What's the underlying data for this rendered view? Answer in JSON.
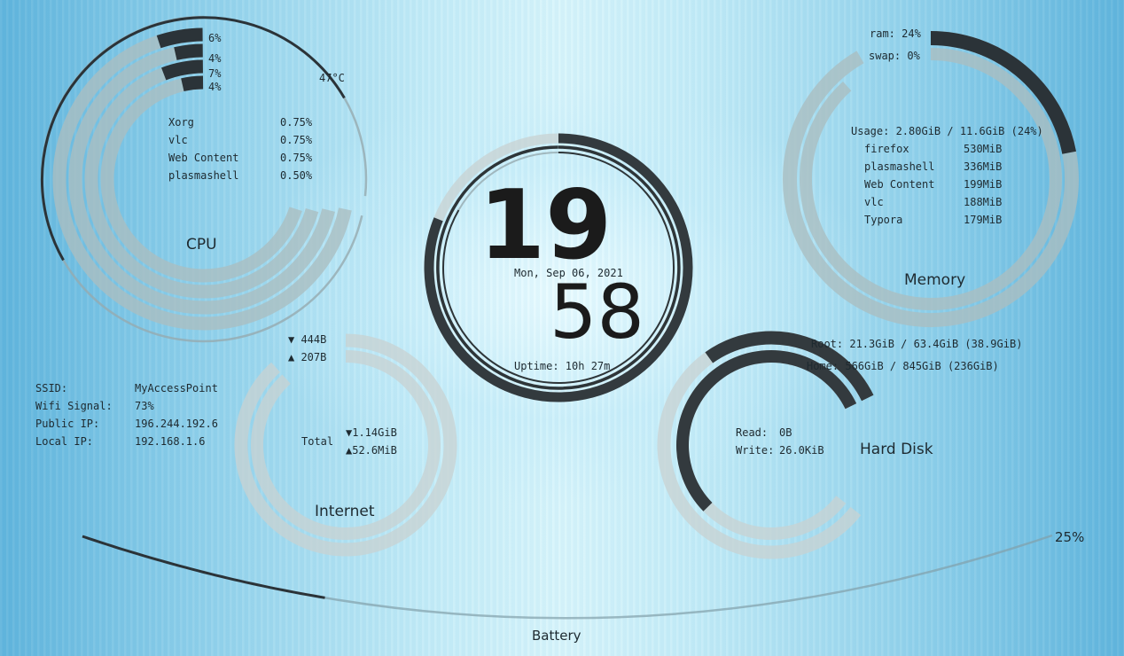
{
  "colors": {
    "dark": "#2b3338",
    "track": "rgba(170,190,192,0.78)",
    "track_light": "rgba(200,210,210,0.75)",
    "thin_light": "rgba(150,170,175,0.8)"
  },
  "cpu": {
    "title": "CPU",
    "temp": "47°C",
    "cores": [
      "6%",
      "4%",
      "7%",
      "4%"
    ],
    "core_values": [
      6,
      4,
      7,
      4
    ],
    "temp_value": 47,
    "top": [
      {
        "name": "Xorg",
        "value": "0.75%"
      },
      {
        "name": "vlc",
        "value": "0.75%"
      },
      {
        "name": "Web Content",
        "value": "0.75%"
      },
      {
        "name": "plasmashell",
        "value": "0.50%"
      }
    ]
  },
  "clock": {
    "hour": "19",
    "minute": "58",
    "date": "Mon, Sep 06, 2021",
    "uptime": "Uptime: 10h 27m"
  },
  "memory": {
    "title": "Memory",
    "ram": "ram: 24%",
    "swap": "swap: 0%",
    "ram_value": 24,
    "swap_value": 0,
    "usage": "Usage: 2.80GiB / 11.6GiB (24%)",
    "top": [
      {
        "name": "firefox",
        "value": "530MiB"
      },
      {
        "name": "plasmashell",
        "value": "336MiB"
      },
      {
        "name": "Web Content",
        "value": "199MiB"
      },
      {
        "name": "vlc",
        "value": "188MiB"
      },
      {
        "name": "Typora",
        "value": "179MiB"
      }
    ]
  },
  "network": {
    "title": "Internet",
    "down_rate": "▼ 444B",
    "up_rate": "▲ 207B",
    "total_label": "Total",
    "total_down": "▼1.14GiB",
    "total_up": "▲52.6MiB",
    "info": [
      {
        "label": "SSID:",
        "value": "MyAccessPoint"
      },
      {
        "label": "Wifi Signal:",
        "value": "73%"
      },
      {
        "label": "Public IP:",
        "value": "196.244.192.6"
      },
      {
        "label": "Local IP:",
        "value": "192.168.1.6"
      }
    ]
  },
  "disk": {
    "title": "Hard Disk",
    "root": "Root: 21.3GiB / 63.4GiB (38.9GiB)",
    "home": "Home: 566GiB / 845GiB (236GiB)",
    "root_fraction": 0.336,
    "home_fraction": 0.67,
    "read_label": "Read:",
    "read_value": "0B",
    "write_label": "Write:",
    "write_value": "26.0KiB"
  },
  "battery": {
    "title": "Battery",
    "percent": "25%",
    "value": 25
  }
}
